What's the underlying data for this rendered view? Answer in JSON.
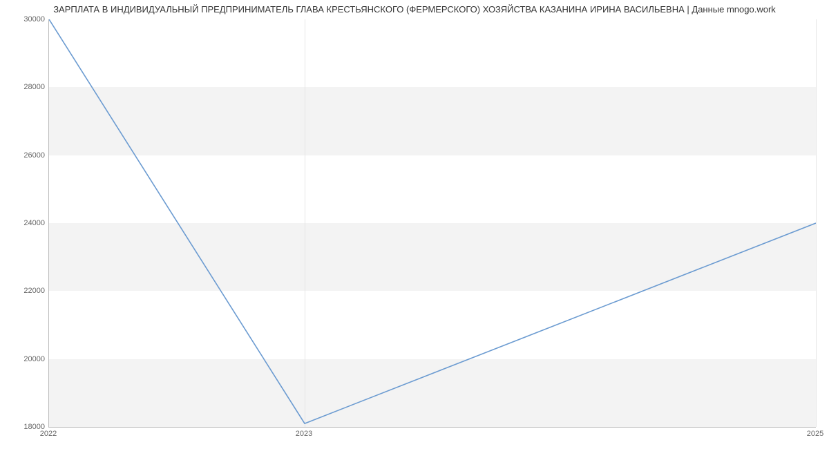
{
  "title": "ЗАРПЛАТА В ИНДИВИДУАЛЬНЫЙ ПРЕДПРИНИМАТЕЛЬ ГЛАВА КРЕСТЬЯНСКОГО (ФЕРМЕРСКОГО) ХОЗЯЙСТВА КАЗАНИНА ИРИНА ВАСИЛЬЕВНА | Данные mnogo.work",
  "chart_data": {
    "type": "line",
    "x": [
      2022,
      2023,
      2025
    ],
    "y": [
      30000,
      18100,
      24000
    ],
    "y_ticks": [
      18000,
      20000,
      22000,
      24000,
      26000,
      28000,
      30000
    ],
    "x_ticks": [
      2022,
      2023,
      2025
    ],
    "ylim": [
      18000,
      30000
    ],
    "xlim": [
      2022,
      2025
    ],
    "title": "ЗАРПЛАТА В ИНДИВИДУАЛЬНЫЙ ПРЕДПРИНИМАТЕЛЬ ГЛАВА КРЕСТЬЯНСКОГО (ФЕРМЕРСКОГО) ХОЗЯЙСТВА КАЗАНИНА ИРИНА ВАСИЛЬЕВНА | Данные mnogo.work",
    "xlabel": "",
    "ylabel": ""
  },
  "colors": {
    "line": "#6b9bd1",
    "band": "#f3f3f3",
    "axis": "#bbbbbb"
  }
}
